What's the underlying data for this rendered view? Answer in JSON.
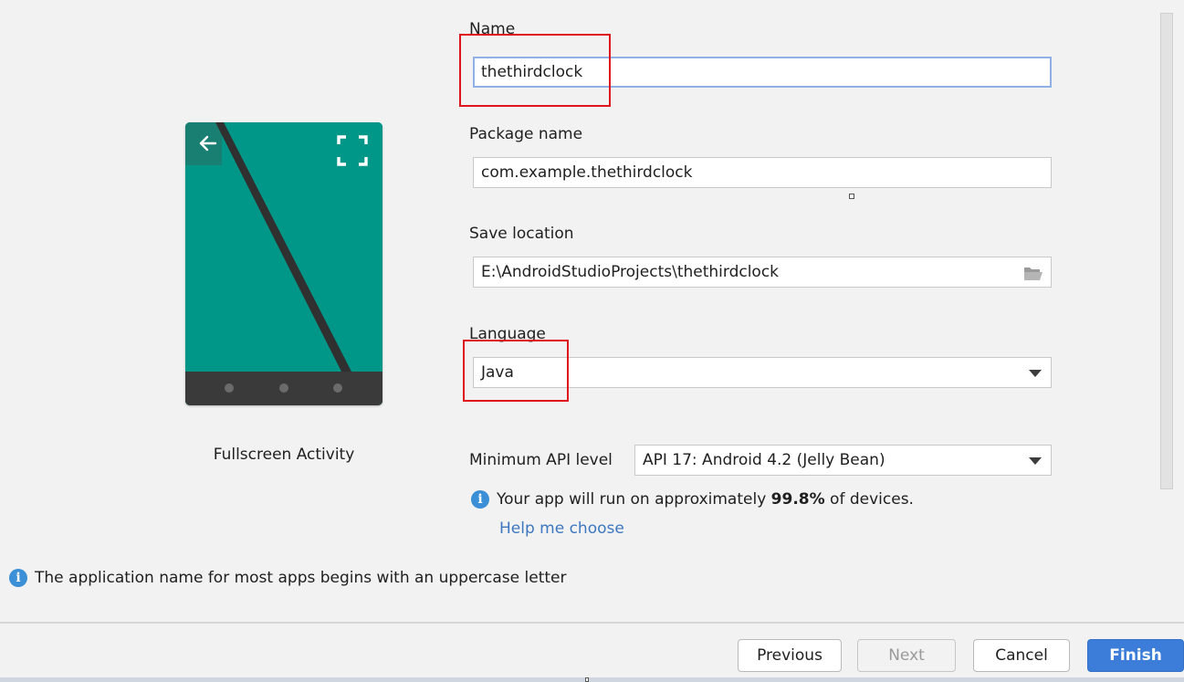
{
  "preview": {
    "activity_name": "Fullscreen Activity",
    "colors": {
      "teal": "#009688",
      "dark": "#303030",
      "navbar": "#3a3a3a"
    }
  },
  "form": {
    "name_label": "Name",
    "name_value": "thethirdclock",
    "package_label": "Package name",
    "package_value": "com.example.thethirdclock",
    "save_location_label": "Save location",
    "save_location_value": "E:\\AndroidStudioProjects\\thethirdclock",
    "language_label": "Language",
    "language_value": "Java",
    "min_api_label": "Minimum API level",
    "min_api_value": "API 17: Android 4.2 (Jelly Bean)",
    "coverage_prefix": "Your app will run on approximately ",
    "coverage_percent": "99.8%",
    "coverage_suffix": " of devices.",
    "help_link": "Help me choose"
  },
  "warning": {
    "icon": "info-icon",
    "text": "The application name for most apps begins with an uppercase letter"
  },
  "buttons": {
    "previous": "Previous",
    "next": "Next",
    "cancel": "Cancel",
    "finish": "Finish"
  },
  "colors": {
    "accent": "#3b7dd8",
    "link": "#3d77bf",
    "highlight": "#e0141c",
    "info": "#3a8fd6"
  }
}
